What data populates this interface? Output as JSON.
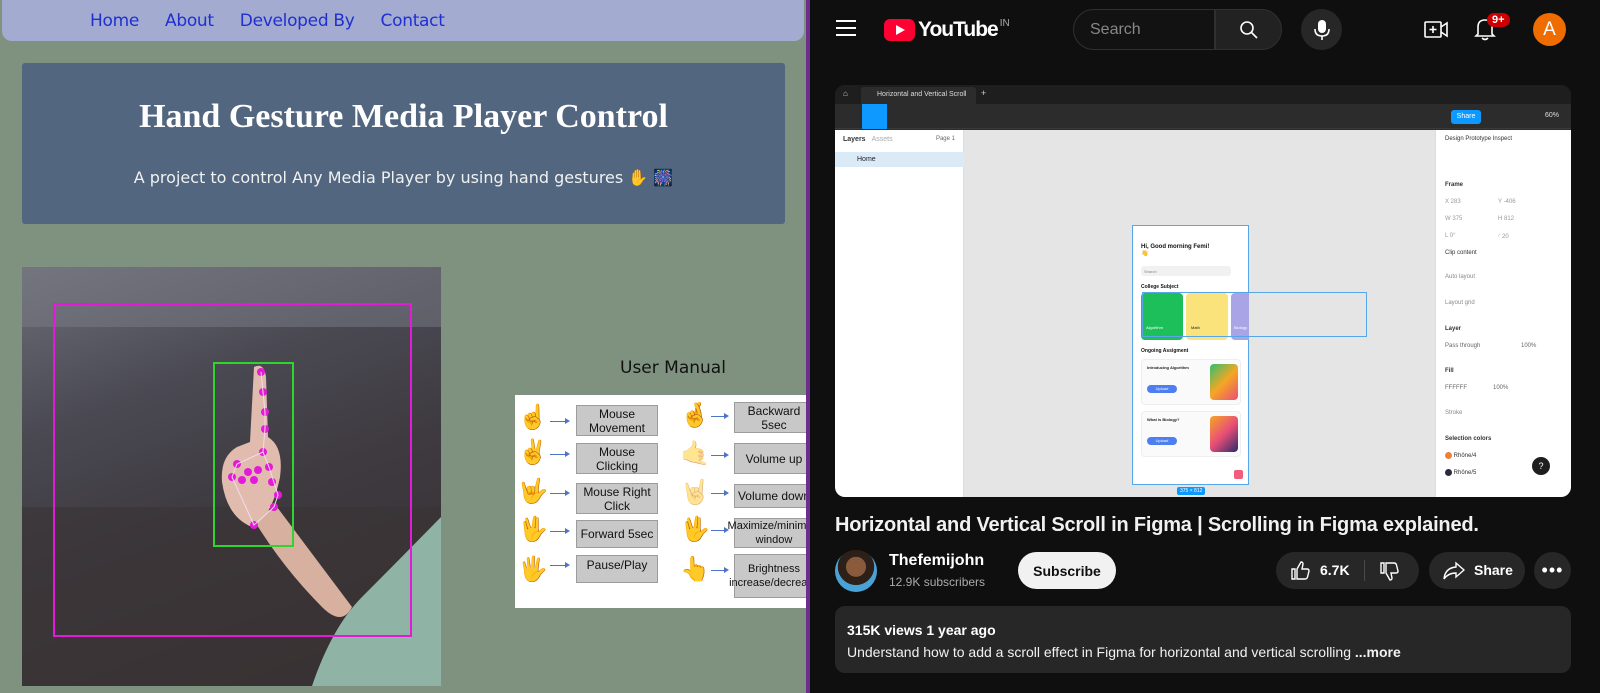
{
  "left": {
    "nav": [
      "Home",
      "About",
      "Developed By",
      "Contact"
    ],
    "hero_title": "Hand Gesture Media Player Control",
    "hero_subtitle": "A project to control Any Media Player by using hand gestures ✋ 🎆",
    "manual_title": "User Manual",
    "manual": {
      "left_col": [
        {
          "icon": "☝️",
          "label": "Mouse Movement"
        },
        {
          "icon": "✌️",
          "label": "Mouse Clicking"
        },
        {
          "icon": "🤟",
          "label": "Mouse Right Click"
        },
        {
          "icon": "🖖",
          "label": "Forward 5sec"
        },
        {
          "icon": "🖐️",
          "label": "Pause/Play"
        }
      ],
      "right_col": [
        {
          "icon": "🤞",
          "label": "Backward 5sec"
        },
        {
          "icon": "🤙",
          "label": "Volume up"
        },
        {
          "icon": "🤘",
          "label": "Volume down"
        },
        {
          "icon": "🖖",
          "label": "Maximize/minimize window"
        },
        {
          "icon": "👆",
          "label": "Brightness increase/decrease"
        }
      ]
    }
  },
  "youtube": {
    "logo_word": "YouTube",
    "country_code": "IN",
    "search_placeholder": "Search",
    "notif_badge": "9+",
    "avatar_letter": "A",
    "video": {
      "tab_title": "Horizontal and Vertical Scroll",
      "share_label": "Share",
      "zoom": "60%",
      "layers_label": "Layers",
      "assets_label": "Assets",
      "page_label": "Page 1",
      "layer_item": "Home",
      "props_tabs": "Design   Prototype   Inspect",
      "frame_label": "Frame",
      "frame_x": "283",
      "frame_y": "-406",
      "frame_w": "375",
      "frame_h": "812",
      "frame_r": "0°",
      "frame_radius": "20",
      "clip": "Clip content",
      "auto_layout": "Auto layout",
      "layout_grid": "Layout grid",
      "layer": "Layer",
      "pass_through": "Pass through",
      "opacity": "100%",
      "fill": "Fill",
      "fill_hex": "FFFFFF",
      "stroke": "Stroke",
      "selection_colors": "Selection colors",
      "color1": "Rhône/4",
      "color2": "Rhône/5",
      "phone_greeting": "Hi, Good morning Femi! 👋",
      "phone_search": "Search",
      "phone_section": "College Subject",
      "phone_card1": "Algorithm",
      "phone_card2": "Math",
      "phone_card3": "Biology",
      "phone_ongoing": "Ongoing Assigment",
      "phone_item1": "Introducing Algorithm",
      "phone_item2": "What is Biology?",
      "phone_btn": "Upload",
      "frame_size": "375 × 812"
    },
    "title": "Horizontal and Vertical Scroll in Figma | Scrolling in Figma explained.",
    "channel_name": "Thefemijohn",
    "subscribers": "12.9K subscribers",
    "subscribe_label": "Subscribe",
    "likes": "6.7K",
    "share_label": "Share",
    "views_line": "315K views  1 year ago",
    "description": "Understand how to add a scroll effect in Figma for horizontal and vertical scrolling",
    "more_label": " ...more",
    "colors": {
      "brand_red": "#ff0033",
      "bg": "#0f0f0f",
      "avatar": "#ef6c00",
      "figma_blue": "#0d99ff"
    }
  }
}
